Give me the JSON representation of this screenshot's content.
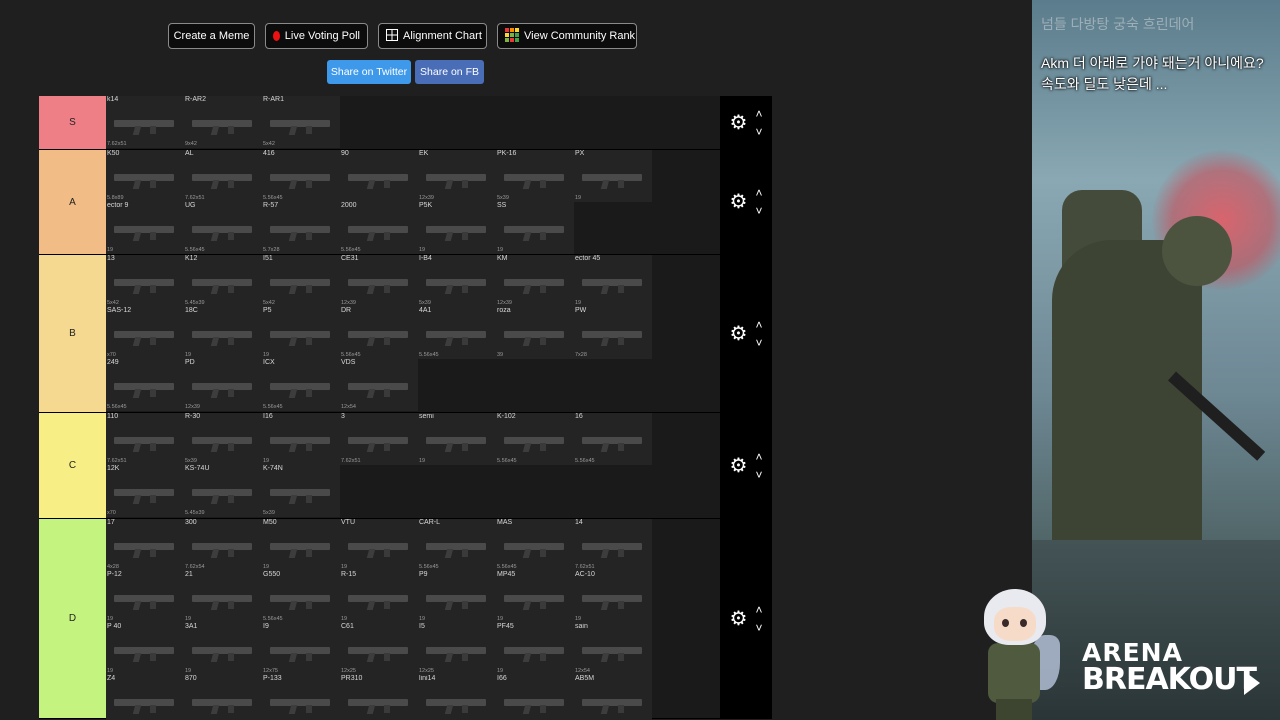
{
  "toolbar": {
    "create_meme": "Create a Meme",
    "live_poll": "Live Voting Poll",
    "alignment": "Alignment Chart",
    "community": "View Community Rank"
  },
  "share": {
    "twitter": "Share on Twitter",
    "fb": "Share on FB"
  },
  "tiers": [
    {
      "label": "S",
      "color": "#ef7f86",
      "items": [
        {
          "name": "k14",
          "cal": "7.62x51"
        },
        {
          "name": "R-AR2",
          "cal": "9x42"
        },
        {
          "name": "R-AR1",
          "cal": "5x42"
        }
      ]
    },
    {
      "label": "A",
      "color": "#f2bc86",
      "items": [
        {
          "name": "K50",
          "cal": "5.8x89"
        },
        {
          "name": "AL",
          "cal": "7.62x51"
        },
        {
          "name": "416",
          "cal": "5.56x45"
        },
        {
          "name": "90",
          "cal": ""
        },
        {
          "name": "EK",
          "cal": "12x39"
        },
        {
          "name": "PK-16",
          "cal": "5x39"
        },
        {
          "name": "PX",
          "cal": "19"
        },
        {
          "name": "ector 9",
          "cal": "19"
        },
        {
          "name": "UG",
          "cal": "5.56x45"
        },
        {
          "name": "R-57",
          "cal": "5.7x28"
        },
        {
          "name": "2000",
          "cal": "5.56x45"
        },
        {
          "name": "P5K",
          "cal": "19"
        },
        {
          "name": "SS",
          "cal": "19"
        }
      ]
    },
    {
      "label": "B",
      "color": "#f5d990",
      "items": [
        {
          "name": "13",
          "cal": "5x42"
        },
        {
          "name": "K12",
          "cal": "5.45x39"
        },
        {
          "name": "I51",
          "cal": "5x42"
        },
        {
          "name": "CE31",
          "cal": "12x39"
        },
        {
          "name": "I-B4",
          "cal": "5x39"
        },
        {
          "name": "KM",
          "cal": "12x39"
        },
        {
          "name": "ector 45",
          "cal": "19"
        },
        {
          "name": "SAS-12",
          "cal": "x70"
        },
        {
          "name": "18C",
          "cal": "19"
        },
        {
          "name": "P5",
          "cal": "19"
        },
        {
          "name": "DR",
          "cal": "5.56x45"
        },
        {
          "name": "4A1",
          "cal": "5.56x45"
        },
        {
          "name": "roza",
          "cal": "39"
        },
        {
          "name": "PW",
          "cal": "7x28"
        },
        {
          "name": "249",
          "cal": "5.56x45"
        },
        {
          "name": "PD",
          "cal": "12x39"
        },
        {
          "name": "ICX",
          "cal": "5.56x45"
        },
        {
          "name": "VDS",
          "cal": "12x54"
        }
      ]
    },
    {
      "label": "C",
      "color": "#f7ee85",
      "items": [
        {
          "name": "110",
          "cal": "7.62x51"
        },
        {
          "name": "R-30",
          "cal": "5x39"
        },
        {
          "name": "I16",
          "cal": "19"
        },
        {
          "name": "3",
          "cal": "7.62x51"
        },
        {
          "name": "semi",
          "cal": "19"
        },
        {
          "name": "K-102",
          "cal": "5.56x45"
        },
        {
          "name": "16",
          "cal": "5.56x45"
        },
        {
          "name": "12K",
          "cal": "x70"
        },
        {
          "name": "KS-74U",
          "cal": "5.45x39"
        },
        {
          "name": "K-74N",
          "cal": "5x39"
        }
      ]
    },
    {
      "label": "D",
      "color": "#c5f37f",
      "items": [
        {
          "name": "17",
          "cal": "4x28"
        },
        {
          "name": "300",
          "cal": "7.62x54"
        },
        {
          "name": "M50",
          "cal": "19"
        },
        {
          "name": "VTU",
          "cal": "19"
        },
        {
          "name": "CAR-L",
          "cal": "5.56x45"
        },
        {
          "name": "MAS",
          "cal": "5.56x45"
        },
        {
          "name": "14",
          "cal": "7.62x51"
        },
        {
          "name": "P-12",
          "cal": "19"
        },
        {
          "name": "21",
          "cal": "19"
        },
        {
          "name": "G550",
          "cal": "5.56x45"
        },
        {
          "name": "R-15",
          "cal": "19"
        },
        {
          "name": "P9",
          "cal": "19"
        },
        {
          "name": "MP45",
          "cal": "19"
        },
        {
          "name": "AC-10",
          "cal": "19"
        },
        {
          "name": "P 40",
          "cal": "19"
        },
        {
          "name": "3A1",
          "cal": "19"
        },
        {
          "name": "I9",
          "cal": "12x75"
        },
        {
          "name": "C61",
          "cal": "12x25"
        },
        {
          "name": "I5",
          "cal": "12x25"
        },
        {
          "name": "PF45",
          "cal": "19"
        },
        {
          "name": "sain",
          "cal": "12x54"
        },
        {
          "name": "Z4",
          "cal": ""
        },
        {
          "name": "870",
          "cal": ""
        },
        {
          "name": "P-133",
          "cal": ""
        },
        {
          "name": "PR310",
          "cal": ""
        },
        {
          "name": "lini14",
          "cal": ""
        },
        {
          "name": "I66",
          "cal": ""
        },
        {
          "name": "AB5M",
          "cal": ""
        }
      ]
    }
  ],
  "stream": {
    "overlay_top": "넘들 다방탕 궁숙 흐린데어",
    "chat": "Akm 더 아래로 가야 돼는거 아니에요? 속도와 딜도 낮은데 ...",
    "logo_line1": "ARENA",
    "logo_line2": "BREAKOUT"
  },
  "icons": {
    "gear": "gear-icon",
    "up": "chevron-up-icon",
    "down": "chevron-down-icon",
    "poll": "red-dot-icon",
    "alignment": "grid-icon",
    "community": "color-grid-icon"
  }
}
